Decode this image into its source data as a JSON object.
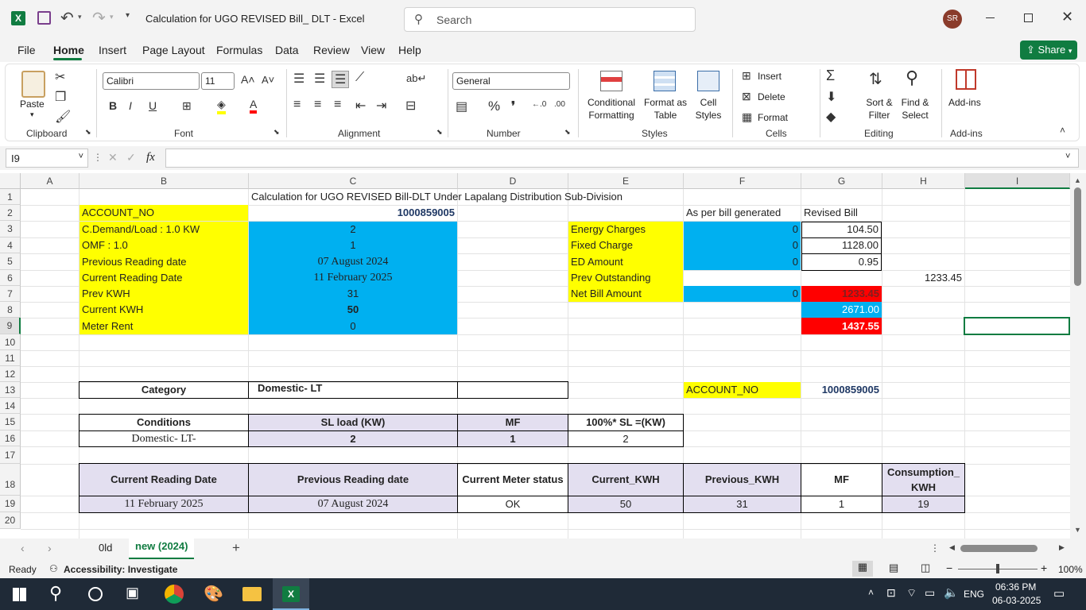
{
  "title_bar": {
    "doc_title": "Calculation for UGO REVISED Bill_ DLT  -  Excel",
    "search_placeholder": "Search",
    "avatar_initials": "SR",
    "icons": [
      "excel-logo-icon",
      "save-icon",
      "undo-icon",
      "redo-icon",
      "customize-icon",
      "minimize-icon",
      "restore-icon",
      "close-icon"
    ]
  },
  "menu": {
    "tabs": [
      "File",
      "Home",
      "Insert",
      "Page Layout",
      "Formulas",
      "Data",
      "Review",
      "View",
      "Help"
    ],
    "active": "Home",
    "share_label": "Share"
  },
  "ribbon": {
    "clipboard": {
      "label": "Clipboard",
      "paste": "Paste"
    },
    "font": {
      "label": "Font",
      "name": "Calibri",
      "size": "11"
    },
    "alignment": {
      "label": "Alignment"
    },
    "number": {
      "label": "Number",
      "format": "General"
    },
    "styles": {
      "label": "Styles",
      "cond1": "Conditional",
      "cond2": "Formatting",
      "fmt1": "Format as",
      "fmt2": "Table",
      "cell1": "Cell",
      "cell2": "Styles"
    },
    "cells": {
      "label": "Cells",
      "insert": "Insert",
      "delete": "Delete",
      "format": "Format"
    },
    "editing": {
      "label": "Editing",
      "sort1": "Sort &",
      "sort2": "Filter",
      "find1": "Find &",
      "find2": "Select"
    },
    "addins": {
      "label": "Add-ins",
      "btn": "Add-ins"
    }
  },
  "formula_bar": {
    "name_box": "I9",
    "fx": "fx",
    "formula": ""
  },
  "columns": [
    "A",
    "B",
    "C",
    "D",
    "E",
    "F",
    "G",
    "H",
    "I"
  ],
  "rows": [
    "1",
    "2",
    "3",
    "4",
    "5",
    "6",
    "7",
    "8",
    "9",
    "10",
    "11",
    "12",
    "13",
    "14",
    "15",
    "16",
    "17",
    "18",
    "19",
    "20"
  ],
  "cells": {
    "c1": "Calculation for UGO REVISED Bill-DLT Under Lapalang Distribution Sub-Division",
    "b2": "ACCOUNT_NO",
    "c2": "1000859005",
    "f2": "As per bill generated",
    "g2": "Revised Bill",
    "b3": "C.Demand/Load : 1.0 KW",
    "c3": "2",
    "e3": "Energy Charges",
    "f3": "0",
    "g3": "104.50",
    "b4": "OMF : 1.0",
    "c4": "1",
    "e4": "Fixed Charge",
    "f4": "0",
    "g4": "1128.00",
    "b5": "Previous Reading date",
    "c5": "07 August 2024",
    "e5": "ED Amount",
    "f5": "0",
    "g5": "0.95",
    "b6": "Current Reading Date",
    "c6": "11 February 2025",
    "e6": "Prev Outstanding",
    "h6": "1233.45",
    "b7": "Prev KWH",
    "c7": "31",
    "e7": "Net Bill Amount",
    "f7": "0",
    "g7": "1233.45",
    "b8": "Current KWH",
    "c8": "50",
    "g8": "2671.00",
    "b9": "Meter Rent",
    "c9": "0",
    "g9": "1437.55",
    "b13": "Category",
    "c13": "Domestic- LT",
    "f13": "ACCOUNT_NO",
    "g13": "1000859005",
    "b15": "Conditions",
    "c15": "SL load (KW)",
    "d15": "MF",
    "e15": "100%* SL =(KW)",
    "b16": "Domestic- LT-",
    "c16": "2",
    "d16": "1",
    "e16": "2",
    "b18": "Current Reading Date",
    "c18": "Previous Reading date",
    "d18": "Current Meter status",
    "e18": "Current_KWH",
    "f18": "Previous_KWH",
    "g18": "MF",
    "h18": "Consumption_KWH",
    "b19": "11 February 2025",
    "c19": "07 August 2024",
    "d19": "OK",
    "e19": "50",
    "f19": "31",
    "g19": "1",
    "h19": "19"
  },
  "sheet_tabs": [
    "0ld",
    "new (2024)"
  ],
  "active_sheet": "new (2024)",
  "status": {
    "ready": "Ready",
    "accessibility": "Accessibility: Investigate",
    "zoom": "100%"
  },
  "taskbar": {
    "time": "06:36 PM",
    "date": "06-03-2025",
    "lang": "ENG"
  }
}
